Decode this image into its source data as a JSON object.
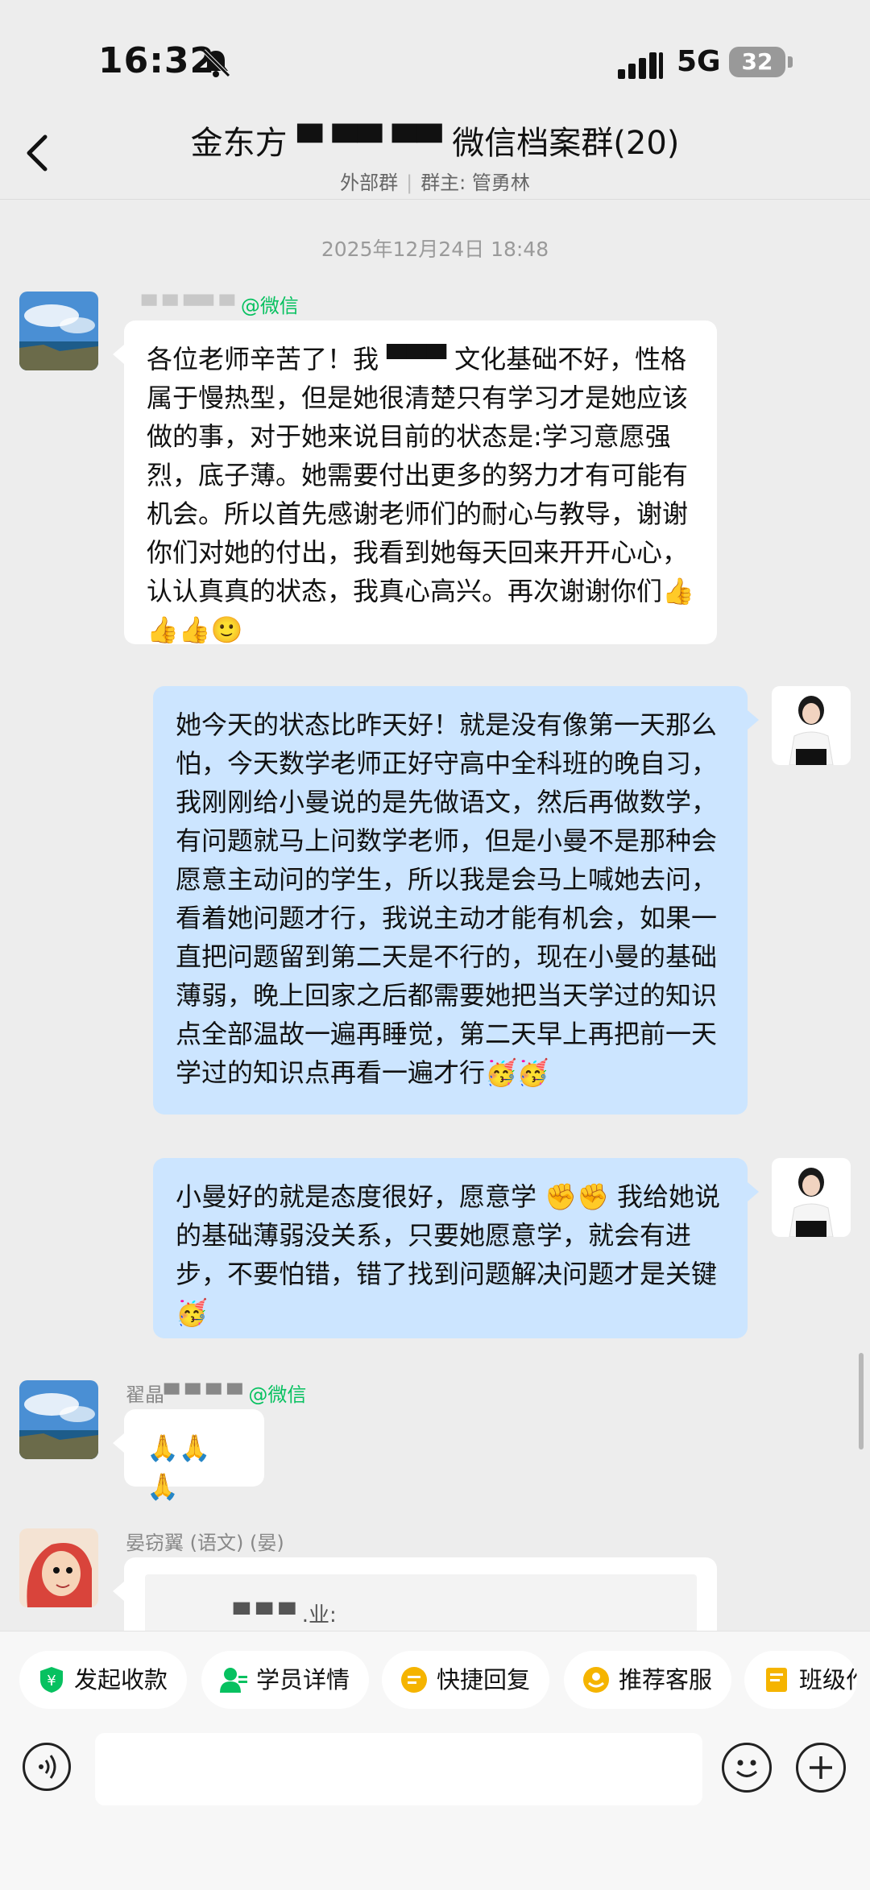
{
  "status": {
    "time": "16:32",
    "network": "5G",
    "battery": "32"
  },
  "header": {
    "title": "金东方 ▀ ▀▀  ▀▀ 微信档案群(20)",
    "subtitle_left": "外部群",
    "subtitle_right": "群主: 管勇林"
  },
  "timestamp": "2025年12月24日 18:48",
  "messages": [
    {
      "sender": "▀ ▀ ▀▀ ▀",
      "sender_tag": "@微信",
      "text": "各位老师辛苦了！我 ▀▀▀ 文化基础不好，性格属于慢热型，但是她很清楚只有学习才是她应该做的事，对于她来说目前的状态是:学习意愿强烈，底子薄。她需要付出更多的努力才有可能有机会。所以首先感谢老师们的耐心与教导，谢谢你们对她的付出，我看到她每天回来开开心心，认认真真的状态，我真心高兴。再次谢谢你们"
    },
    {
      "text": "她今天的状态比昨天好！就是没有像第一天那么怕，今天数学老师正好守高中全科班的晚自习，我刚刚给小曼说的是先做语文，然后再做数学，有问题就马上问数学老师，但是小曼不是那种会愿意主动问的学生，所以我是会马上喊她去问，看着她问题才行，我说主动才能有机会，如果一直把问题留到第二天是不行的，现在小曼的基础薄弱，晚上回家之后都需要她把当天学过的知识点全部温故一遍再睡觉，第二天早上再把前一天学过的知识点再看一遍才行"
    },
    {
      "text": "小曼好的就是态度很好，愿意学 ✊✊ 我给她说的基础薄弱没关系，只要她愿意学，就会有进步，不要怕错，错了找到问题解决问题才是关键"
    },
    {
      "sender": "翟晶▀ ▀ ▀ ▀",
      "sender_tag": "@微信",
      "text": "🙏🙏🙏"
    },
    {
      "sender": "晏窃翼 (语文) (晏)",
      "quote": "▀ ▀ ▀ .业:"
    }
  ],
  "emojis": {
    "thumb": "👍",
    "smile": "🙂",
    "party": "🥳",
    "fist": "✊"
  },
  "chips": [
    "发起收款",
    "学员详情",
    "快捷回复",
    "推荐客服",
    "班级作"
  ],
  "colors": {
    "bubble_blue": "#cce5ff",
    "wechat_green": "#07c160",
    "bg": "#ededed"
  },
  "icons": [
    "bell-muted-icon",
    "signal-icon",
    "back-icon",
    "voice-icon",
    "emoji-icon",
    "plus-icon"
  ]
}
